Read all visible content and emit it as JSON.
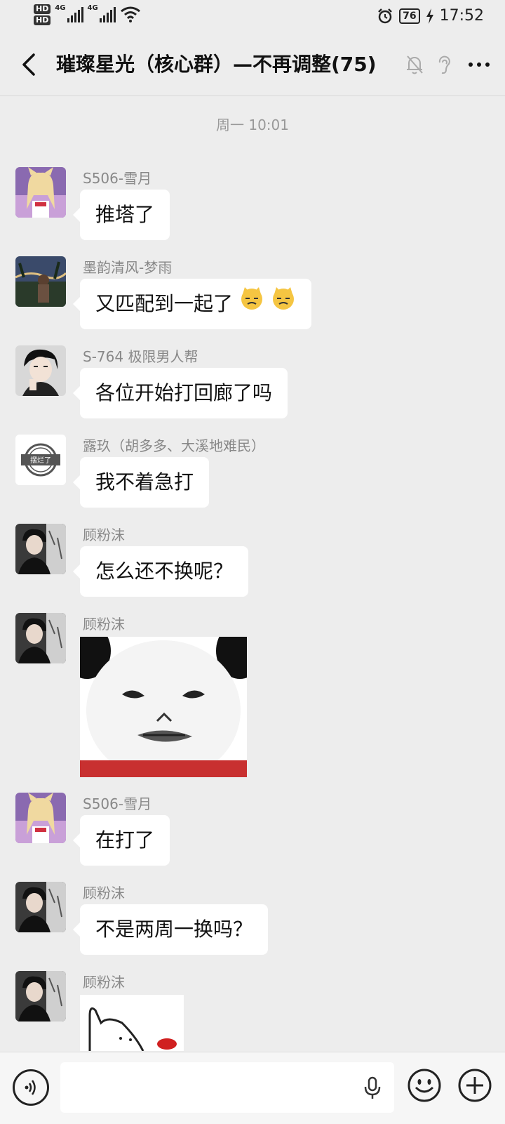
{
  "status_bar": {
    "hd1": "HD",
    "hd2": "HD",
    "net1": "4G",
    "net2": "4G",
    "battery": "76",
    "time": "17:52"
  },
  "header": {
    "title": "璀璨星光（核心群）—不再调整(75)"
  },
  "timestamp": "周一 10:01",
  "messages": [
    {
      "sender": "S506-雪月",
      "text": "推塔了"
    },
    {
      "sender": "墨韵清风-梦雨",
      "text": "又匹配到一起了",
      "emoji": "[捂脸猫][捂脸猫]"
    },
    {
      "sender": "S-764  极限男人帮",
      "text": "各位开始打回廊了吗"
    },
    {
      "sender": "露玖（胡多多、大溪地难民）",
      "text": "我不着急打",
      "avatar_text": "摆烂了"
    },
    {
      "sender": "顾粉沫",
      "text": "怎么还不换呢？"
    },
    {
      "sender": "顾粉沫",
      "image": "panda-meme-sticker"
    },
    {
      "sender": "S506-雪月",
      "text": "在打了"
    },
    {
      "sender": "顾粉沫",
      "text": "不是两周一换吗？"
    },
    {
      "sender": "顾粉沫",
      "image": "cat-sticker"
    }
  ],
  "input": {
    "placeholder": ""
  }
}
